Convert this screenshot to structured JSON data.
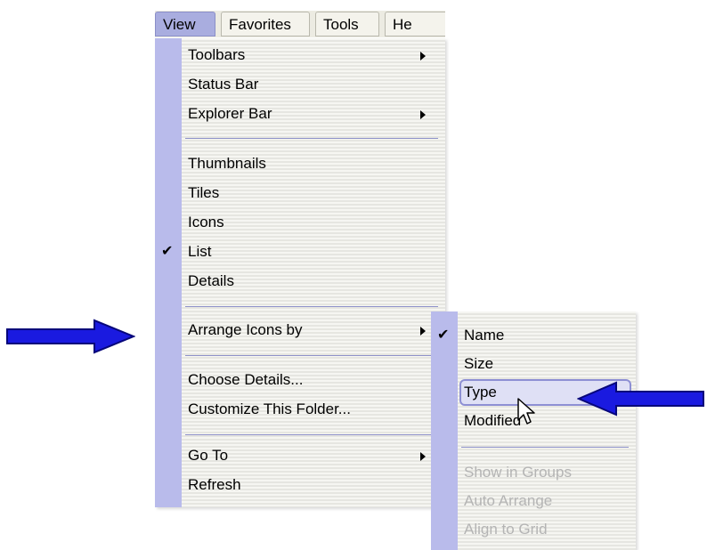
{
  "menubar": {
    "items": [
      {
        "label": "View",
        "active": true
      },
      {
        "label": "Favorites",
        "active": false
      },
      {
        "label": "Tools",
        "active": false
      },
      {
        "label": "He",
        "active": false
      }
    ]
  },
  "view_menu": {
    "items": [
      {
        "label": "Toolbars",
        "submenu": true
      },
      {
        "label": "Status Bar",
        "submenu": false
      },
      {
        "label": "Explorer Bar",
        "submenu": true
      },
      {
        "label": "Thumbnails",
        "submenu": false
      },
      {
        "label": "Tiles",
        "submenu": false
      },
      {
        "label": "Icons",
        "submenu": false
      },
      {
        "label": "List",
        "submenu": false,
        "checked": true,
        "check_glyph": "✔"
      },
      {
        "label": "Details",
        "submenu": false
      },
      {
        "label": "Arrange Icons by",
        "submenu": true
      },
      {
        "label": "Choose Details...",
        "submenu": false
      },
      {
        "label": "Customize This Folder...",
        "submenu": false
      },
      {
        "label": "Go To",
        "submenu": true
      },
      {
        "label": "Refresh",
        "submenu": false
      }
    ]
  },
  "arrange_submenu": {
    "items": [
      {
        "label": "Name",
        "checked": true,
        "check_glyph": "✔",
        "disabled": false
      },
      {
        "label": "Size",
        "checked": false,
        "disabled": false
      },
      {
        "label": "Type",
        "checked": false,
        "disabled": false,
        "highlighted": true
      },
      {
        "label": "Modified",
        "checked": false,
        "disabled": false
      },
      {
        "label": "Show in Groups",
        "checked": false,
        "disabled": true
      },
      {
        "label": "Auto Arrange",
        "checked": false,
        "disabled": true
      },
      {
        "label": "Align to Grid",
        "checked": false,
        "disabled": true
      }
    ]
  },
  "colors": {
    "menu_gutter": "#b9bbeb",
    "highlight_border": "#8e90d4",
    "arrow_fill": "#1a1ae0"
  }
}
